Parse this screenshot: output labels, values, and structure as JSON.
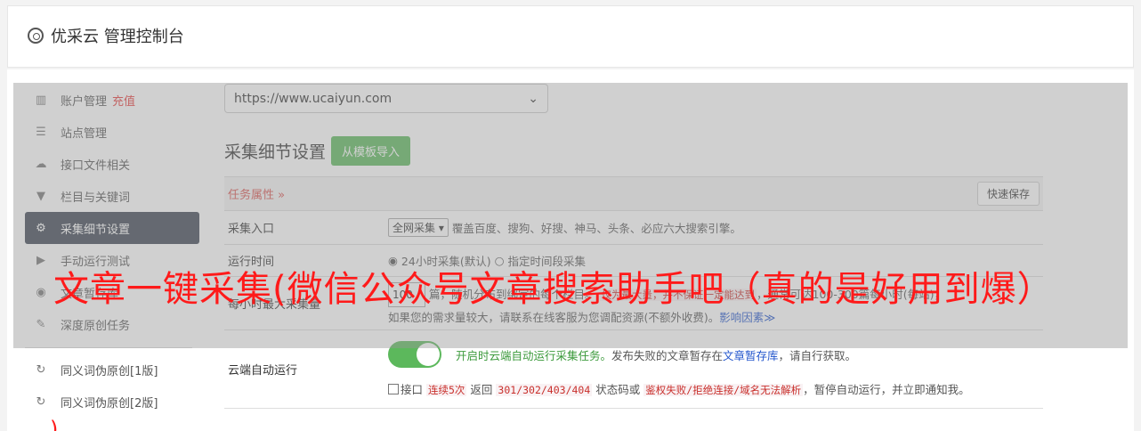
{
  "header": {
    "title": "优采云 管理控制台",
    "icon": "gear-icon"
  },
  "sidebar": {
    "items": [
      {
        "label": "账户管理",
        "icon": "bar-chart-icon",
        "badge": "充值"
      },
      {
        "label": "站点管理",
        "icon": "server-icon"
      },
      {
        "label": "接口文件相关",
        "icon": "cloud-upload-icon"
      },
      {
        "label": "栏目与关键词",
        "icon": "filter-icon"
      },
      {
        "label": "采集细节设置",
        "icon": "gears-icon",
        "active": true
      },
      {
        "label": "手动运行测试",
        "icon": "play-icon"
      },
      {
        "label": "文章暂存库",
        "icon": "database-icon"
      },
      {
        "label": "深度原创任务",
        "icon": "edit-icon"
      }
    ],
    "items2": [
      {
        "label": "同义词伪原创[1版]",
        "icon": "refresh-icon"
      },
      {
        "label": "同义词伪原创[2版]",
        "icon": "refresh-icon"
      }
    ]
  },
  "main": {
    "site_select": "https://www.ucaiyun.com",
    "section_title": "采集细节设置",
    "import_button": "从模板导入",
    "task_attr": "任务属性 »",
    "save_button": "快速保存",
    "rows": {
      "entry_label": "采集入口",
      "entry_select": "全网采集",
      "entry_desc": "覆盖百度、搜狗、好搜、神马、头条、必应六大搜索引擎。",
      "time_label": "运行时间",
      "time_opt1": "24小时采集(默认)",
      "time_opt2": "指定时间段采集",
      "max_label": "每小时最大采集量",
      "max_value": "100",
      "max_text1": "篇，随机分布到绑定的每个栏目。",
      "max_note": "仅为最大量，并不保证一定能达到",
      "max_text2": "，通常可达100-300篇每小时(每站)，",
      "max_text3": "如果您的需求量较大，请联系在线客服为您调配资源(不额外收费)。",
      "max_link": "影响因素",
      "cloud_label": "云端自动运行",
      "cloud_text1": "开启时云端自动运行采集任务。",
      "cloud_text2": "发布失败的文章暂存在",
      "cloud_link": "文章暂存库",
      "cloud_text3": "，请自行获取。",
      "fail_text1": "接口",
      "fail_code1": "连续5次",
      "fail_text2": "返回",
      "fail_code2": "301/302/403/404",
      "fail_text3": "状态码或",
      "fail_code3": "鉴权失败/拒绝连接/域名无法解析",
      "fail_text4": "，暂停自动运行，并立即通知我。"
    }
  },
  "overlay": {
    "headline": "文章一键采集(微信公众号文章搜索助手吧（真的是好用到爆）",
    "tail": ")"
  },
  "colors": {
    "accent_green": "#5cb85c",
    "sidebar_active": "#3c4452",
    "headline_red": "#ff1a1a"
  }
}
